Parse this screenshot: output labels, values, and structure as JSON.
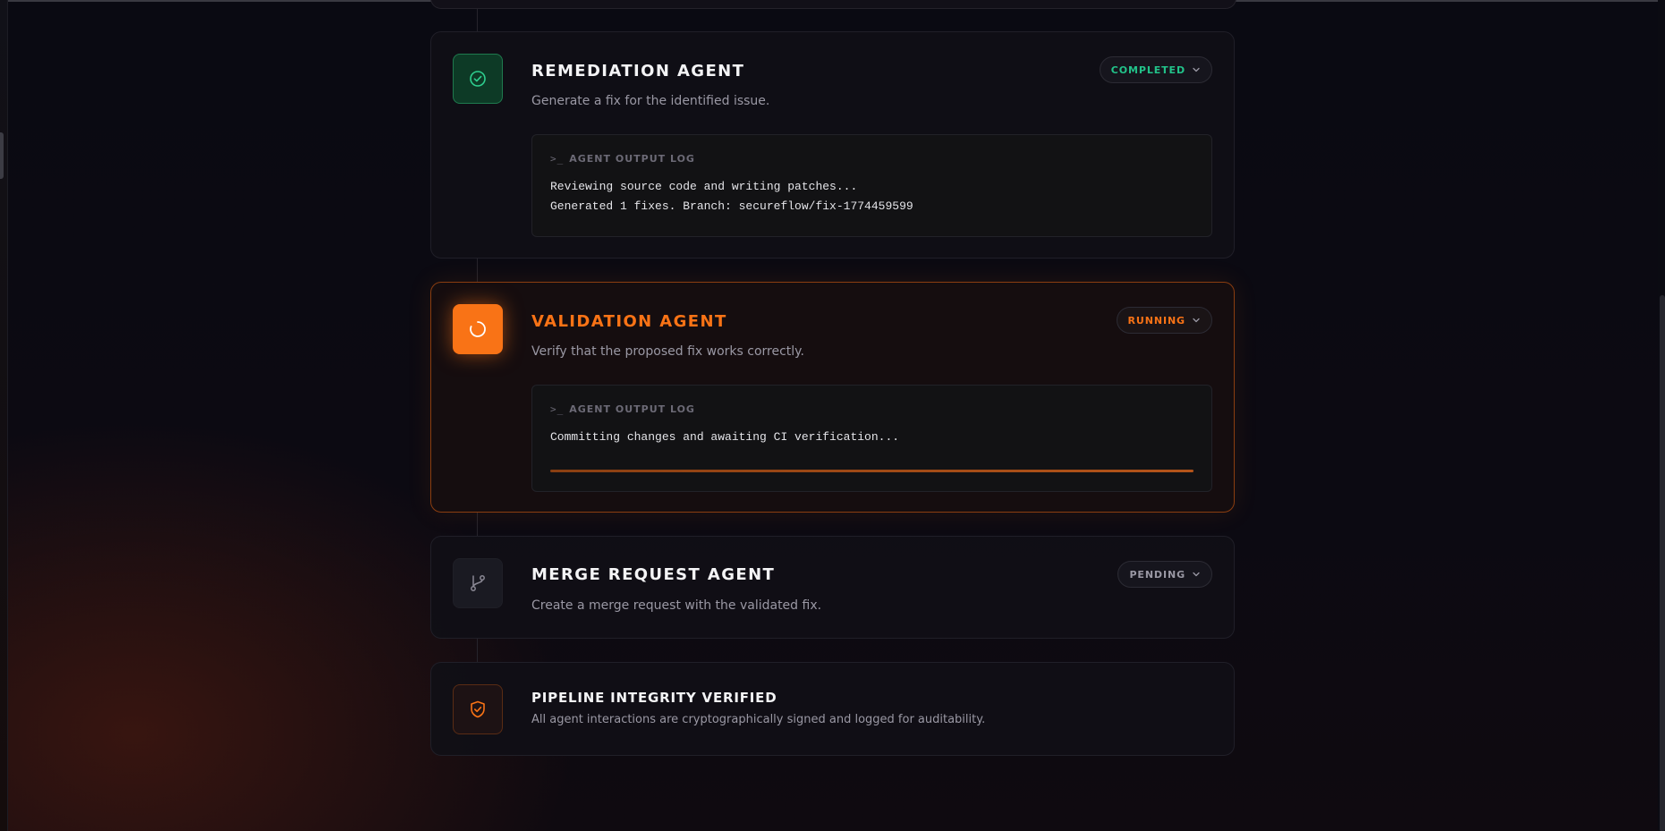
{
  "colors": {
    "accent": "#f97316",
    "success": "#22c38a",
    "muted": "#9a98a4"
  },
  "agents": [
    {
      "title": "REMEDIATION AGENT",
      "description": "Generate a fix for the identified issue.",
      "status": "COMPLETED",
      "icon": "check-circle-icon",
      "log": {
        "prompt": ">_",
        "header": "AGENT OUTPUT LOG",
        "lines": [
          "Reviewing source code and writing patches...",
          "Generated 1 fixes. Branch: secureflow/fix-1774459599"
        ]
      }
    },
    {
      "title": "VALIDATION AGENT",
      "description": "Verify that the proposed fix works correctly.",
      "status": "RUNNING",
      "icon": "spinner-icon",
      "log": {
        "prompt": ">_",
        "header": "AGENT OUTPUT LOG",
        "lines": [
          "Committing changes and awaiting CI verification..."
        ],
        "progress": 1.0
      }
    },
    {
      "title": "MERGE REQUEST AGENT",
      "description": "Create a merge request with the validated fix.",
      "status": "PENDING",
      "icon": "git-branch-icon"
    }
  ],
  "footer": {
    "title": "PIPELINE INTEGRITY VERIFIED",
    "description": "All agent interactions are cryptographically signed and logged for auditability.",
    "icon": "shield-check-icon"
  }
}
